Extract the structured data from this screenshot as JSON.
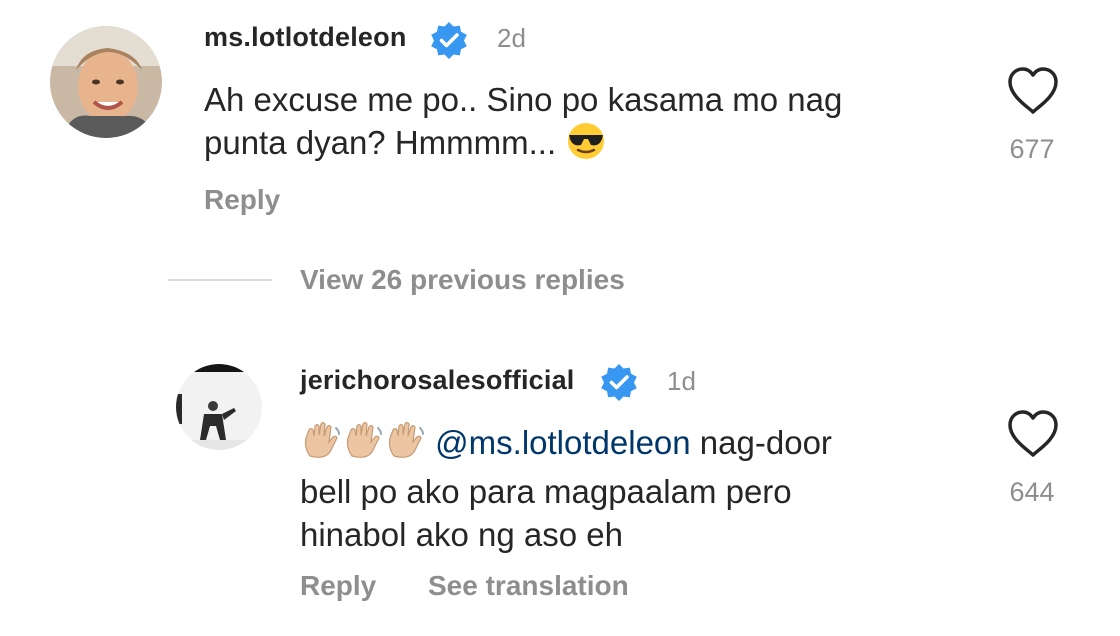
{
  "comment": {
    "username": "ms.lotlotdeleon",
    "time": "2d",
    "text": "Ah excuse me po.. Sino po kasama mo nag punta dyan? Hmmmm...",
    "text_line1": "Ah excuse me po.. Sino po kasama mo nag",
    "text_line2": "punta dyan?  Hmmmm...",
    "emoji": "sunglasses-emoji",
    "likes": "677",
    "reply_label": "Reply"
  },
  "view_replies_label": "View 26 previous replies",
  "reply": {
    "username": "jerichorosalesofficial",
    "time": "1d",
    "emoji": "waving-hand-emoji",
    "mention": "@ms.lotlotdeleon",
    "text_line1_rest": " nag-door",
    "text_line2": "bell po ako para magpaalam pero",
    "text_line3": "hinabol ako ng aso eh",
    "likes": "644",
    "reply_label": "Reply",
    "translate_label": "See translation"
  },
  "colors": {
    "verified": "#3897f0",
    "secondary_text": "#8e8e8e",
    "primary_text": "#262626",
    "mention": "#00376b"
  }
}
